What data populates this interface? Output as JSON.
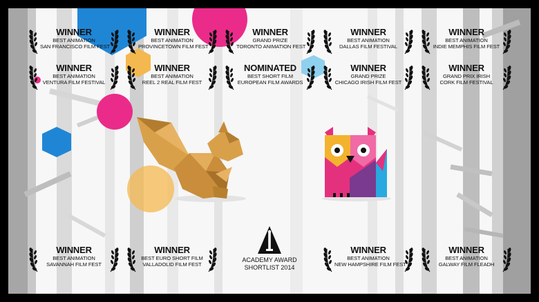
{
  "laurels": [
    {
      "status": "WINNER",
      "line1": "BEST ANIMATION",
      "line2": "SAN FRANCISCO FILM FEST"
    },
    {
      "status": "WINNER",
      "line1": "BEST ANIMATION",
      "line2": "PROVINCETOWN FILM FEST"
    },
    {
      "status": "WINNER",
      "line1": "GRAND PRIZE",
      "line2": "TORONTO ANIMATION FEST"
    },
    {
      "status": "WINNER",
      "line1": "BEST ANIMATION",
      "line2": "DALLAS FILM FESTIVAL"
    },
    {
      "status": "WINNER",
      "line1": "BEST ANIMATION",
      "line2": "INDIE MEMPHIS FILM FEST"
    },
    {
      "status": "WINNER",
      "line1": "BEST ANIMATION",
      "line2": "VENTURA FILM FESTIVAL"
    },
    {
      "status": "WINNER",
      "line1": "BEST ANIMATION",
      "line2": "REEL 2 REAL FILM FEST"
    },
    {
      "status": "NOMINATED",
      "line1": "BEST SHORT FILM",
      "line2": "EUROPEAN FILM AWARDS"
    },
    {
      "status": "WINNER",
      "line1": "GRAND PRIZE",
      "line2": "CHICAGO IRISH FILM FEST"
    },
    {
      "status": "WINNER",
      "line1": "GRAND PRIX IRISH",
      "line2": "CORK FILM FESTIVAL"
    },
    {
      "status": "WINNER",
      "line1": "BEST ANIMATION",
      "line2": "SAVANNAH FILM FEST"
    },
    {
      "status": "WINNER",
      "line1": "BEST EURO SHORT FILM",
      "line2": "VALLADOLID FILM FEST"
    },
    {
      "status": "WINNER",
      "line1": "BEST ANIMATION",
      "line2": "NEW HAMPSHIRE FILM FEST"
    },
    {
      "status": "WINNER",
      "line1": "BEST ANIMATION",
      "line2": "GALWAY FILM FLEADH"
    }
  ],
  "oscar": {
    "line1": "ACADEMY AWARD",
    "line2": "SHORTLIST 2014"
  },
  "colors": {
    "background": "#f7f7f7",
    "frame": "#000000",
    "blue": "#1f86d6",
    "pink": "#ea2b8a",
    "orange": "#f4b850",
    "light_blue": "#8fd0ee",
    "squirrel": "#d9a04a",
    "fox_pink": "#e4317e",
    "fox_purple": "#7a3a8f",
    "fox_orange": "#f4b32e",
    "fox_cyan": "#29a9df"
  }
}
